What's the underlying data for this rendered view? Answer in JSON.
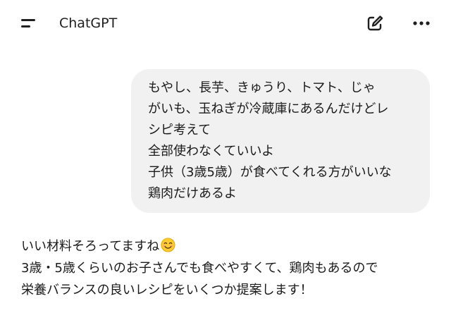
{
  "header": {
    "title": "ChatGPT",
    "menu_icon": "menu-icon",
    "new_chat_icon": "edit-icon",
    "more_icon": "more-horizontal-icon"
  },
  "conversation": {
    "user_message": {
      "lines": [
        "もやし、長芋、きゅうり、トマト、じゃ",
        "がいも、玉ねぎが冷蔵庫にあるんだけどレ",
        "シピ考えて",
        "全部使わなくていいよ",
        "子供（3歳5歳）が食べてくれる方がいいな",
        "鶏肉だけあるよ"
      ]
    },
    "assistant_message": {
      "lines": [
        "いい材料そろってますね",
        "3歳・5歳くらいのお子さんでも食べやすくて、鶏肉もあるので",
        "栄養バランスの良いレシピをいくつか提案します！"
      ],
      "emoji": "smiling-face-emoji"
    }
  },
  "colors": {
    "bubble_background": "#f1f1f1",
    "text": "#1a1a1a",
    "background": "#ffffff"
  }
}
